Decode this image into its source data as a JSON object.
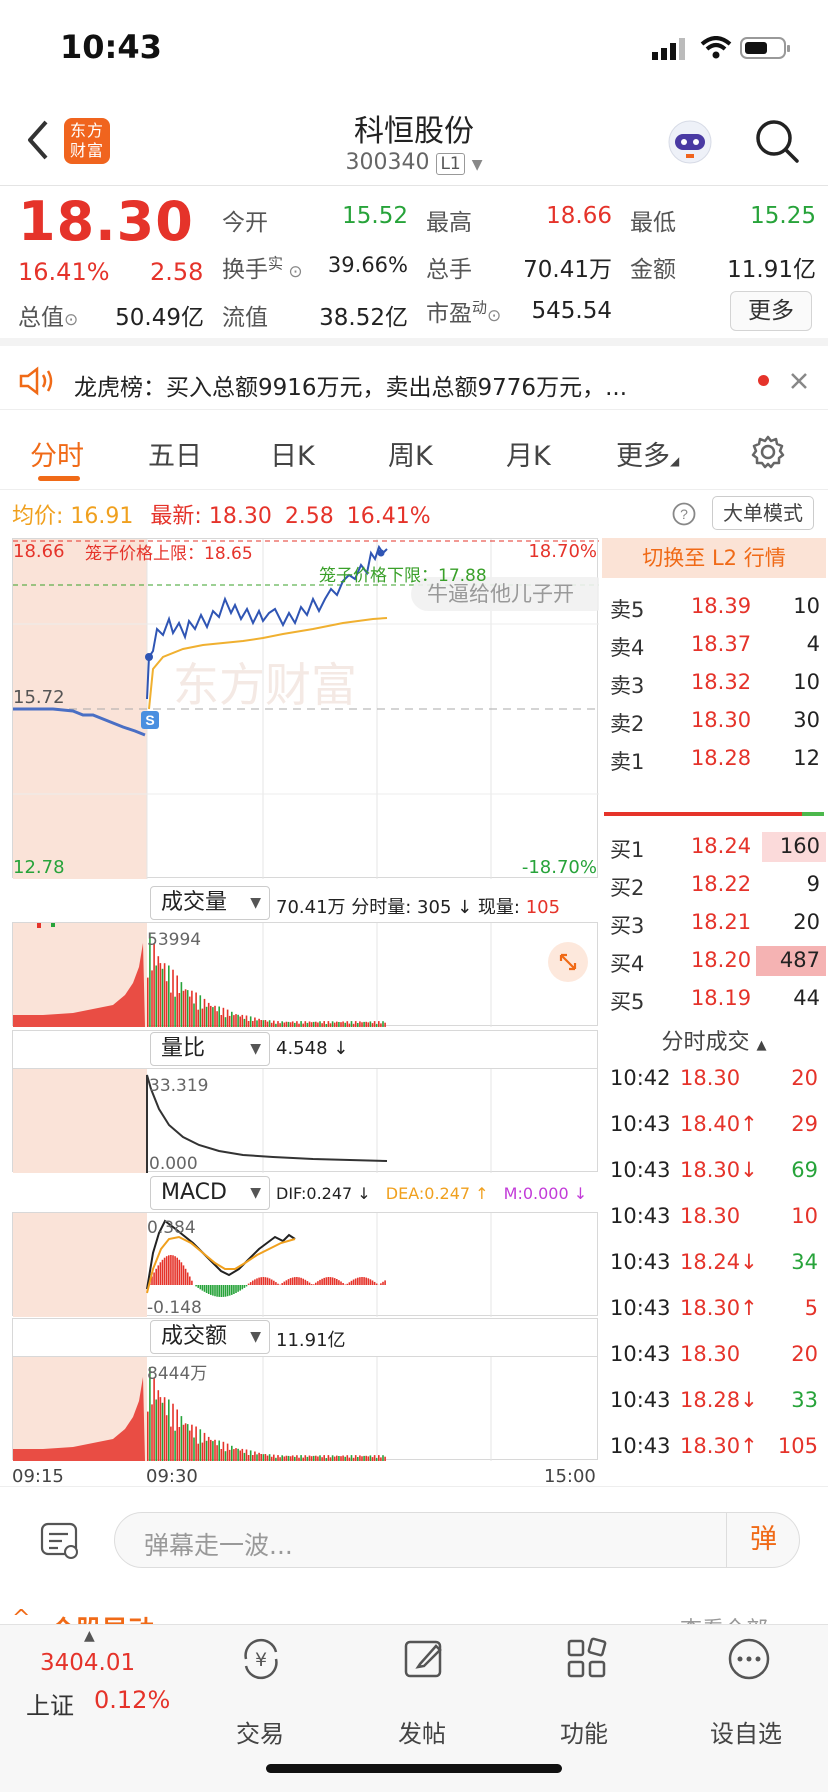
{
  "status_bar": {
    "time": "10:43"
  },
  "header": {
    "logo_text": "东方财富",
    "title": "科恒股份",
    "code": "300340",
    "level": "L1"
  },
  "quote": {
    "price": "18.30",
    "change_pct": "16.41%",
    "change": "2.58",
    "items": [
      {
        "label": "今开",
        "value": "15.52",
        "color": "green"
      },
      {
        "label": "最高",
        "value": "18.66",
        "color": "red"
      },
      {
        "label": "最低",
        "value": "15.25",
        "color": "green"
      },
      {
        "label": "换手",
        "sup": "实",
        "value": "39.66%",
        "color": "dark"
      },
      {
        "label": "总手",
        "value": "70.41万",
        "color": "dark"
      },
      {
        "label": "金额",
        "value": "11.91亿",
        "color": "dark"
      },
      {
        "label": "总值",
        "value": "50.49亿",
        "color": "dark"
      },
      {
        "label": "流值",
        "value": "38.52亿",
        "color": "dark"
      },
      {
        "label": "市盈",
        "sup": "动",
        "value": "545.54",
        "color": "dark"
      }
    ],
    "more_label": "更多"
  },
  "news": {
    "text": "龙虎榜：买入总额9916万元，卖出总额9776万元，..."
  },
  "tabs": [
    "分时",
    "五日",
    "日K",
    "周K",
    "月K",
    "更多"
  ],
  "info_bar": {
    "avg_label": "均价:",
    "avg": "16.91",
    "latest_label": "最新:",
    "latest": "18.30",
    "chg": "2.58",
    "pct": "16.41%",
    "big_mode": "大单模式"
  },
  "chart": {
    "top_price": "18.66",
    "top_pct": "18.70%",
    "mid_price": "15.72",
    "bottom_price": "12.78",
    "bottom_pct": "-18.70%",
    "upper_limit_label": "笼子价格上限：18.65",
    "lower_limit_label": "笼子价格下限：17.88",
    "watermark": "东方财富",
    "danmu": "牛逼给他儿子开",
    "sell_badge": "S",
    "time_start": "09:15",
    "time_open": "09:30",
    "time_end": "15:00"
  },
  "orderbook": {
    "switch_label": "切换至 L2 行情",
    "asks": [
      {
        "label": "卖5",
        "price": "18.39",
        "vol": "10"
      },
      {
        "label": "卖4",
        "price": "18.37",
        "vol": "4"
      },
      {
        "label": "卖3",
        "price": "18.32",
        "vol": "10"
      },
      {
        "label": "卖2",
        "price": "18.30",
        "vol": "30"
      },
      {
        "label": "卖1",
        "price": "18.28",
        "vol": "12"
      }
    ],
    "bids": [
      {
        "label": "买1",
        "price": "18.24",
        "vol": "160"
      },
      {
        "label": "买2",
        "price": "18.22",
        "vol": "9"
      },
      {
        "label": "买3",
        "price": "18.21",
        "vol": "20"
      },
      {
        "label": "买4",
        "price": "18.20",
        "vol": "487"
      },
      {
        "label": "买5",
        "price": "18.19",
        "vol": "44"
      }
    ],
    "ticks_title": "分时成交",
    "ticks": [
      {
        "time": "10:42",
        "price": "18.30",
        "dir": "",
        "vol": "20",
        "vcolor": "red"
      },
      {
        "time": "10:43",
        "price": "18.40↑",
        "dir": "up",
        "vol": "29",
        "vcolor": "red"
      },
      {
        "time": "10:43",
        "price": "18.30↓",
        "dir": "down",
        "vol": "69",
        "vcolor": "green"
      },
      {
        "time": "10:43",
        "price": "18.30",
        "dir": "",
        "vol": "10",
        "vcolor": "red"
      },
      {
        "time": "10:43",
        "price": "18.24↓",
        "dir": "down",
        "vol": "34",
        "vcolor": "green"
      },
      {
        "time": "10:43",
        "price": "18.30↑",
        "dir": "up",
        "vol": "5",
        "vcolor": "red"
      },
      {
        "time": "10:43",
        "price": "18.30",
        "dir": "",
        "vol": "20",
        "vcolor": "red"
      },
      {
        "time": "10:43",
        "price": "18.28↓",
        "dir": "down",
        "vol": "33",
        "vcolor": "green"
      },
      {
        "time": "10:43",
        "price": "18.30↑",
        "dir": "up",
        "vol": "105",
        "vcolor": "red"
      }
    ]
  },
  "indicators": {
    "vol": {
      "name": "成交量",
      "total": "70.41万",
      "detail": "分时量: 305 ↓ 现量:",
      "now": "105",
      "max": "53994"
    },
    "ratio": {
      "name": "量比",
      "value": "4.548 ↓",
      "max": "33.319",
      "min": "0.000"
    },
    "macd": {
      "name": "MACD",
      "dif": "DIF:0.247 ↓",
      "dea": "DEA:0.247 ↑",
      "m": "M:0.000 ↓",
      "max": "0.384",
      "min": "-0.148"
    },
    "amount": {
      "name": "成交额",
      "value": "11.91亿",
      "max": "8444万"
    }
  },
  "comment": {
    "placeholder": "弹幕走一波...",
    "send": "弹"
  },
  "footer_peek": {
    "left": "个股异动",
    "right": "查看全部"
  },
  "bottom_nav": {
    "index_value": "3404.01",
    "index_name": "上证",
    "index_pct": "0.12%",
    "items": [
      "交易",
      "发帖",
      "功能",
      "设自选"
    ]
  }
}
